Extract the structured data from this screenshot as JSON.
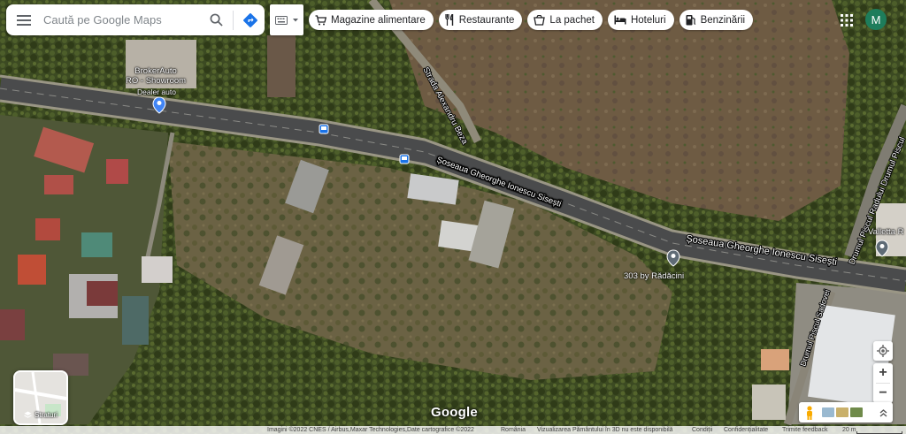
{
  "search": {
    "placeholder": "Caută pe Google Maps"
  },
  "chips": [
    {
      "label": "Magazine alimentare",
      "icon": "cart-icon"
    },
    {
      "label": "Restaurante",
      "icon": "fork-knife-icon"
    },
    {
      "label": "La pachet",
      "icon": "takeout-icon"
    },
    {
      "label": "Hoteluri",
      "icon": "bed-icon"
    },
    {
      "label": "Benzinării",
      "icon": "gas-station-icon"
    }
  ],
  "account": {
    "initial": "M",
    "color": "#1e7d5b"
  },
  "map_labels": {
    "poi_broker": "BrokerAuto",
    "poi_broker_line2": "RO - Showroom",
    "poi_broker_sub": "Dealer auto",
    "street_alexandru": "Strada Alexandru Beza",
    "road_main_upper": "Șoseaua Gheorghe Ionescu Sisești",
    "road_main_lower": "Șoseaua Gheorghe Ionescu Sisești",
    "poi_radacini": "303 by Rădăcini",
    "street_piscul": "Drumul Piscul Radului Drumul Piscul",
    "street_sadovei": "Drumul Piscul Sadovei",
    "poi_valletta": "Valletta R"
  },
  "layers": {
    "label": "Straturi"
  },
  "zoom": {
    "in": "+",
    "out": "−"
  },
  "brand": "Google",
  "footer": {
    "imagery": "Imagini ©2022 CNES / Airbus,Maxar Technologies,Date cartografice ©2022",
    "country": "România",
    "notice": "Vizualizarea Pământului în 3D nu este disponibilă",
    "terms": "Condiții",
    "privacy": "Confidențialitate",
    "feedback": "Trimite feedback",
    "scale": "20 m"
  },
  "colors": {
    "accent": "#1a73e8",
    "poi_blue": "#4285f4",
    "poi_gray": "#5f6b76"
  }
}
